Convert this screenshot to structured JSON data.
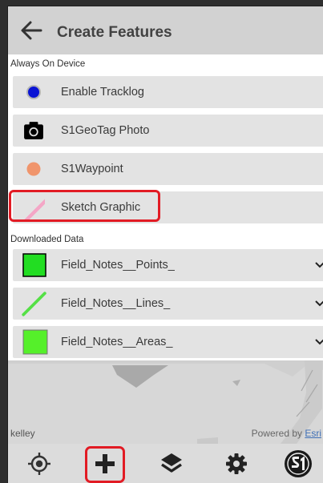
{
  "header": {
    "title": "Create Features",
    "back_icon": "arrow-left-icon"
  },
  "sections": [
    {
      "label": "Always On Device",
      "items": [
        {
          "label": "Enable Tracklog",
          "icon": "blue-dot-icon",
          "color": "#0a14d4"
        },
        {
          "label": "S1GeoTag Photo",
          "icon": "camera-icon",
          "color": "#000000"
        },
        {
          "label": "S1Waypoint",
          "icon": "orange-dot-icon",
          "color": "#f0956c"
        },
        {
          "label": "Sketch Graphic",
          "icon": "pink-line-icon",
          "color": "#f4a6c6",
          "highlighted": true
        }
      ]
    },
    {
      "label": "Downloaded Data",
      "items": [
        {
          "label": "Field_Notes__Points_",
          "icon": "green-square-icon",
          "color": "#22dd22",
          "expandable": true
        },
        {
          "label": "Field_Notes__Lines_",
          "icon": "green-line-icon",
          "color": "#55e046",
          "expandable": true
        },
        {
          "label": "Field_Notes__Areas_",
          "icon": "green-area-icon",
          "color": "#55f02a",
          "expandable": true
        }
      ]
    }
  ],
  "map": {
    "credit_left": "kelley",
    "credit_right_prefix": "Powered by ",
    "credit_right_link": "Esri"
  },
  "toolbar": {
    "buttons": [
      {
        "name": "locate-button",
        "icon": "crosshair-icon"
      },
      {
        "name": "add-feature-button",
        "icon": "plus-icon",
        "highlighted": true
      },
      {
        "name": "layers-button",
        "icon": "layers-icon"
      },
      {
        "name": "settings-button",
        "icon": "gear-icon"
      },
      {
        "name": "s1-logo-button",
        "icon": "s1-logo-icon"
      }
    ]
  },
  "colors": {
    "highlight": "#e21b24",
    "row_bg": "#e3e3e3",
    "header_bg": "#d2d2d2"
  }
}
